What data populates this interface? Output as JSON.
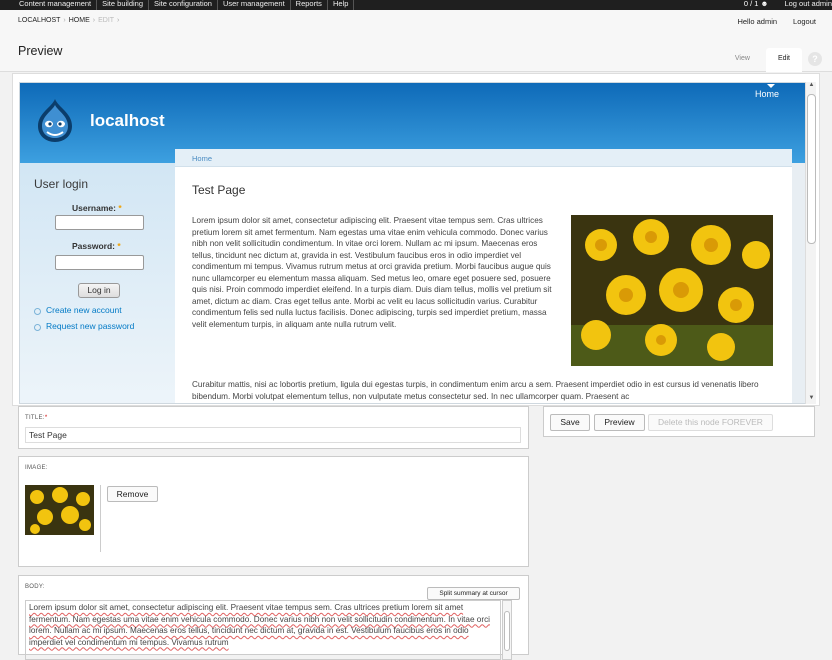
{
  "toolbar": {
    "menu": [
      "Content management",
      "Site building",
      "Site configuration",
      "User management",
      "Reports",
      "Help"
    ],
    "shortcut_count": "0 / 1",
    "logout": "Log out admin"
  },
  "breadcrumb": {
    "items": [
      "LOCALHOST",
      "HOME",
      "EDIT"
    ]
  },
  "user_links": {
    "greeting": "Hello admin",
    "logout": "Logout"
  },
  "page": {
    "title": "Preview",
    "tabs": [
      "View",
      "Edit"
    ],
    "active_tab": "Edit"
  },
  "site": {
    "name": "localhost",
    "nav_home": "Home",
    "breadcrumb": "Home",
    "login": {
      "title": "User login",
      "username_label": "Username:",
      "password_label": "Password:",
      "required_mark": "*",
      "button": "Log in",
      "create_account": "Create new account",
      "request_password": "Request new password"
    },
    "node": {
      "title": "Test Page",
      "body_p1": "Lorem ipsum dolor sit amet, consectetur adipiscing elit. Praesent vitae tempus sem. Cras ultrices pretium lorem sit amet fermentum. Nam egestas uma vitae enim vehicula commodo. Donec varius nibh non velit sollicitudin condimentum. In vitae orci lorem. Nullam ac mi ipsum. Maecenas eros tellus, tincidunt nec dictum at, gravida in est. Vestibulum faucibus eros in odio imperdiet vel condimentum mi tempus. Vivamus rutrum metus at orci gravida pretium. Morbi faucibus augue quis nunc ullamcorper eu elementum massa aliquam. Sed metus leo, omare eget posuere sed, posuere quis nisi. Proin commodo imperdiet eleifend. In a turpis diam. Duis diam tellus, mollis vel pretium sit amet, dictum ac diam. Cras eget tellus ante. Morbi ac velit eu lacus sollicitudin varius. Curabitur condimentum felis sed nulla luctus facilisis. Donec adipiscing, turpis sed imperdiet pretium, massa velit elementum turpis, in aliquam ante nulla rutrum velit.",
      "body_p2": "Curabitur mattis, nisi ac lobortis pretium, ligula dui egestas turpis, in condimentum enim arcu a sem. Praesent imperdiet odio in est cursus id venenatis libero bibendum. Morbi volutpat elementum tellus, non vulputate metus consectetur sed. In nec ullamcorper quam. Praesent ac"
    }
  },
  "form": {
    "title_label": "TITLE:",
    "required_mark": "*",
    "title_value": "Test Page",
    "image_label": "IMAGE:",
    "remove_button": "Remove",
    "body_label": "BODY:",
    "split_button": "Split summary at cursor",
    "body_value": "Lorem ipsum dolor sit amet, consectetur adipiscing elit. Praesent vitae tempus sem. Cras ultrices pretium lorem sit amet fermentum. Nam egestas uma vitae enim vehicula commodo. Donec varius nibh non velit sollicitudin condimentum. In vitae orci lorem. Nullam ac mi ipsum. Maecenas eros tellus, tincidunt nec dictum at, gravida in est. Vestibulum faucibus eros in odio imperdiet vel condimentum mi tempus. Vivamus rutrum",
    "save_button": "Save",
    "preview_button": "Preview",
    "delete_button": "Delete this node FOREVER"
  },
  "colors": {
    "accent": "#0074bd",
    "header_blue": "#1a78c2",
    "toolbar": "#1f1f1f"
  },
  "icons": [
    "drupal-logo-icon",
    "help-icon",
    "shortcut-icon",
    "scroll-up-icon",
    "scroll-down-icon"
  ]
}
